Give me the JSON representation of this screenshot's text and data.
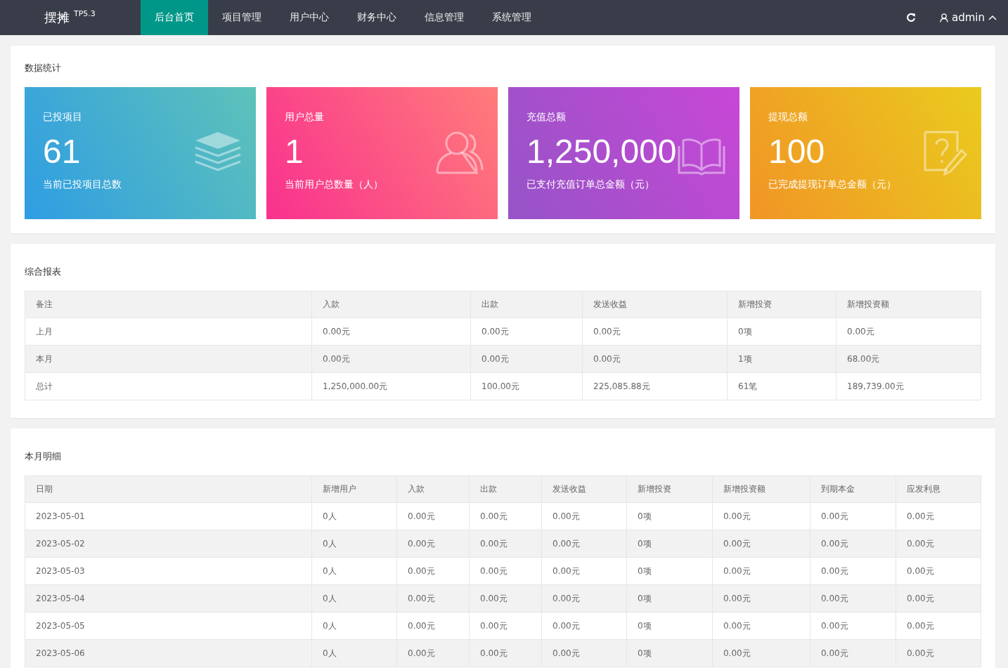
{
  "header": {
    "logo": "摆摊",
    "version": "TP5.3",
    "nav": [
      {
        "label": "后台首页",
        "selected": true
      },
      {
        "label": "项目管理",
        "selected": false
      },
      {
        "label": "用户中心",
        "selected": false
      },
      {
        "label": "财务中心",
        "selected": false
      },
      {
        "label": "信息管理",
        "selected": false
      },
      {
        "label": "系统管理",
        "selected": false
      }
    ],
    "user": "admin"
  },
  "stats": {
    "title": "数据统计",
    "cards": [
      {
        "label": "已投项目",
        "value": "61",
        "note": "当前已投项目总数"
      },
      {
        "label": "用户总量",
        "value": "1",
        "note": "当前用户总数量（人）"
      },
      {
        "label": "充值总额",
        "value": "1,250,000",
        "note": "已支付充值订单总金额（元）"
      },
      {
        "label": "提现总额",
        "value": "100",
        "note": "已完成提现订单总金额（元）"
      }
    ]
  },
  "report": {
    "title": "综合报表",
    "columns": [
      "备注",
      "入款",
      "出款",
      "发送收益",
      "新增投资",
      "新增投资额"
    ],
    "rows": [
      [
        "上月",
        "0.00元",
        "0.00元",
        "0.00元",
        "0项",
        "0.00元"
      ],
      [
        "本月",
        "0.00元",
        "0.00元",
        "0.00元",
        "1项",
        "68.00元"
      ],
      [
        "总计",
        "1,250,000.00元",
        "100.00元",
        "225,085.88元",
        "61笔",
        "189,739.00元"
      ]
    ]
  },
  "monthly": {
    "title": "本月明细",
    "columns": [
      "日期",
      "新增用户",
      "入款",
      "出款",
      "发送收益",
      "新增投资",
      "新增投资额",
      "到期本金",
      "应发利息"
    ],
    "rows": [
      [
        "2023-05-01",
        "0人",
        "0.00元",
        "0.00元",
        "0.00元",
        "0项",
        "0.00元",
        "0.00元",
        "0.00元"
      ],
      [
        "2023-05-02",
        "0人",
        "0.00元",
        "0.00元",
        "0.00元",
        "0项",
        "0.00元",
        "0.00元",
        "0.00元"
      ],
      [
        "2023-05-03",
        "0人",
        "0.00元",
        "0.00元",
        "0.00元",
        "0项",
        "0.00元",
        "0.00元",
        "0.00元"
      ],
      [
        "2023-05-04",
        "0人",
        "0.00元",
        "0.00元",
        "0.00元",
        "0项",
        "0.00元",
        "0.00元",
        "0.00元"
      ],
      [
        "2023-05-05",
        "0人",
        "0.00元",
        "0.00元",
        "0.00元",
        "0项",
        "0.00元",
        "0.00元",
        "0.00元"
      ],
      [
        "2023-05-06",
        "0人",
        "0.00元",
        "0.00元",
        "0.00元",
        "0项",
        "0.00元",
        "0.00元",
        "0.00元"
      ]
    ]
  }
}
